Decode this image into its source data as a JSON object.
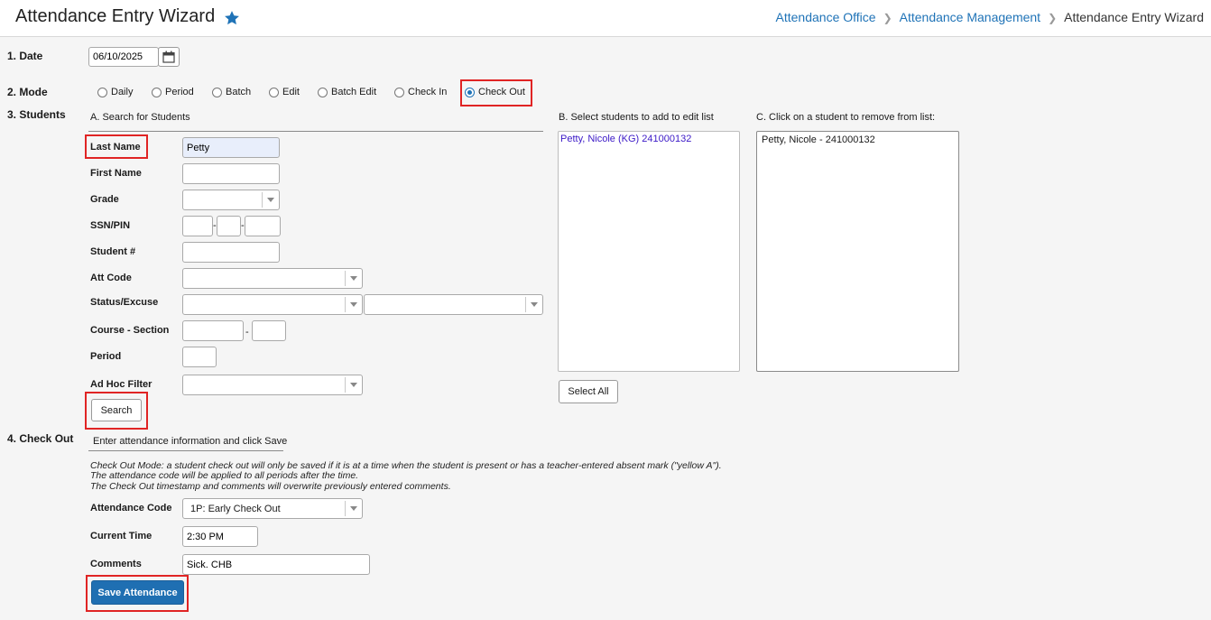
{
  "header": {
    "title": "Attendance Entry Wizard",
    "breadcrumb": [
      "Attendance Office",
      "Attendance Management",
      "Attendance Entry Wizard"
    ]
  },
  "date": {
    "label": "1. Date",
    "value": "06/10/2025"
  },
  "mode": {
    "label": "2. Mode",
    "options": [
      "Daily",
      "Period",
      "Batch",
      "Edit",
      "Batch Edit",
      "Check In",
      "Check Out"
    ],
    "selected": "Check Out"
  },
  "students": {
    "label": "3. Students",
    "search_heading": "A. Search for Students",
    "fields": {
      "last_name": {
        "label": "Last Name",
        "value": "Petty"
      },
      "first_name": {
        "label": "First Name",
        "value": ""
      },
      "grade": {
        "label": "Grade",
        "value": ""
      },
      "ssn": {
        "label": "SSN/PIN"
      },
      "student_num": {
        "label": "Student #",
        "value": ""
      },
      "att_code": {
        "label": "Att Code",
        "value": ""
      },
      "status_excuse": {
        "label": "Status/Excuse"
      },
      "course_section": {
        "label": "Course - Section"
      },
      "period": {
        "label": "Period",
        "value": ""
      },
      "ad_hoc": {
        "label": "Ad Hoc Filter",
        "value": ""
      }
    },
    "search_button": "Search",
    "select_heading": "B. Select students to add to edit list",
    "results": [
      "Petty, Nicole (KG) 241000132"
    ],
    "select_all_button": "Select All",
    "remove_heading": "C. Click on a student to remove from list:",
    "selected_list": [
      "Petty, Nicole - 241000132"
    ]
  },
  "checkout": {
    "label": "4. Check Out",
    "sub_heading": "Enter attendance information and click Save",
    "notes": [
      "Check Out Mode: a student check out will only be saved if it is at a time when the student is present or has a teacher-entered absent mark (\"yellow A\").",
      "The attendance code will be applied to all periods after the time.",
      "The Check Out timestamp and comments will overwrite previously entered comments."
    ],
    "attendance_code": {
      "label": "Attendance Code",
      "value": "1P: Early Check Out"
    },
    "current_time": {
      "label": "Current Time",
      "value": "2:30 PM"
    },
    "comments": {
      "label": "Comments",
      "value": "Sick. CHB"
    },
    "save_button": "Save Attendance"
  },
  "colors": {
    "accent": "#1f73b7",
    "highlight": "#e02424",
    "result_text": "#3b19c7",
    "primary_button": "#1f6fb2"
  }
}
